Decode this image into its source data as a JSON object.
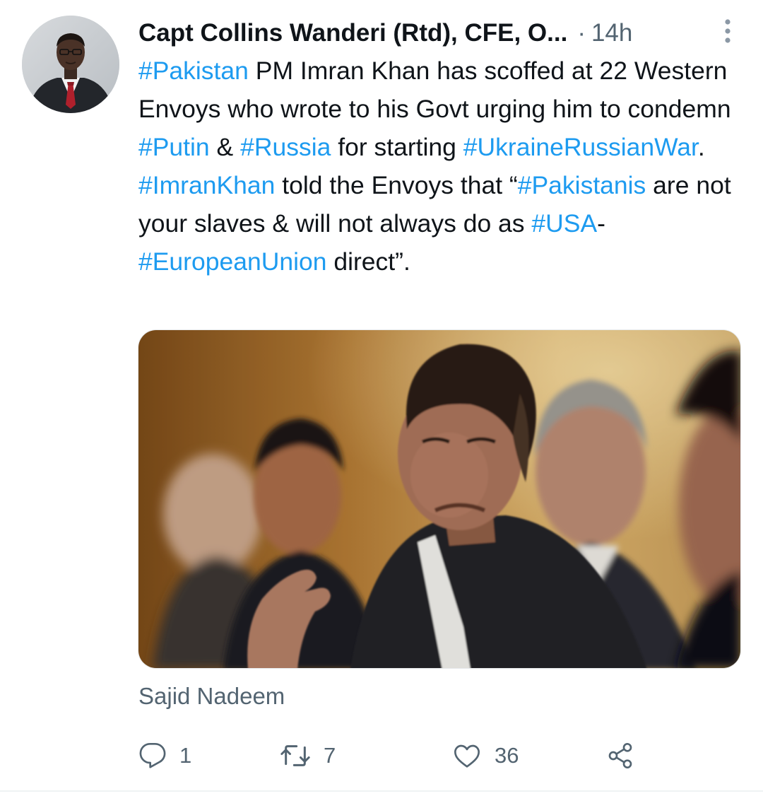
{
  "tweet": {
    "author": "Capt Collins Wanderi (Rtd), CFE, O...",
    "separator": "·",
    "time": "14h",
    "text": {
      "t1": "#Pakistan",
      "t2": " PM Imran Khan has scoffed at 22 Western Envoys who wrote to his Govt urging him to condemn ",
      "t3": "#Putin",
      "t4": " & ",
      "t5": "#Russia",
      "t6": " for starting ",
      "t7": "#UkraineRussianWar",
      "t8": ". ",
      "t9": "#ImranKhan",
      "t10": " told the Envoys that “",
      "t11": "#Pakistanis",
      "t12": " are not your slaves & will not always do as ",
      "t13": "#USA",
      "t14": "-",
      "t15": "#EuropeanUnion",
      "t16": " direct”."
    },
    "media_credit": "Sajid Nadeem",
    "actions": {
      "replies": "1",
      "retweets": "7",
      "likes": "36"
    }
  },
  "colors": {
    "link": "#1d9bf0",
    "secondary_text": "#536471",
    "primary_text": "#0f1419"
  },
  "icons": {
    "more": "more-vertical-icon",
    "reply": "reply-icon",
    "retweet": "retweet-icon",
    "like": "heart-icon",
    "share": "share-icon"
  }
}
